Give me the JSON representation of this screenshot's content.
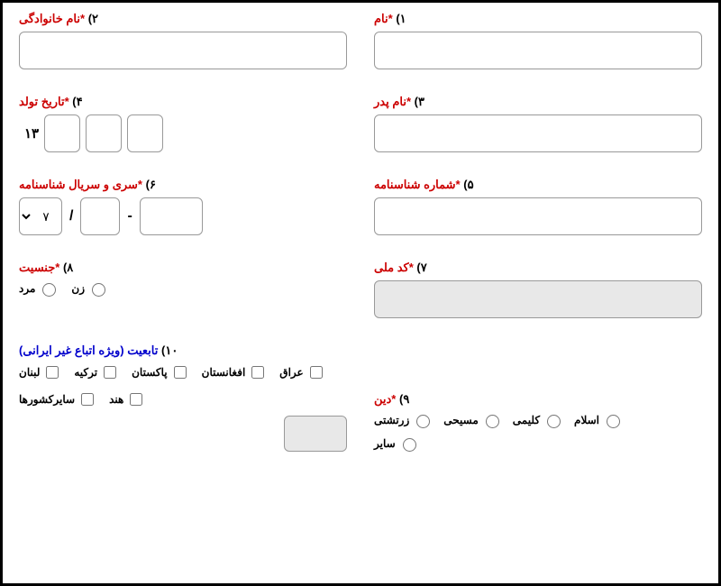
{
  "fields": {
    "f1": {
      "num": "۱)",
      "label": "*نام"
    },
    "f2": {
      "num": "۲)",
      "label": "*نام خانوادگی"
    },
    "f3": {
      "num": "۳)",
      "label": "*نام پدر"
    },
    "f4": {
      "num": "۴)",
      "label": "*تاریخ تولد",
      "prefix": "۱۳"
    },
    "f5": {
      "num": "۵)",
      "label": "*شماره شناسنامه"
    },
    "f6": {
      "num": "۶)",
      "label": "*سری و سریال شناسنامه",
      "sep1": "-",
      "sep2": "/",
      "dropdown": "۷"
    },
    "f7": {
      "num": "۷)",
      "label": "*کد ملی"
    },
    "f8": {
      "num": "۸)",
      "label": "*جنسیت",
      "opts": {
        "f": "زن",
        "m": "مرد"
      }
    },
    "f9": {
      "num": "۹)",
      "label": "*دین",
      "opts": {
        "islam": "اسلام",
        "kalimi": "کلیمی",
        "masihi": "مسیحی",
        "zartoshti": "زرتشتی",
        "other": "سایر"
      }
    },
    "f10": {
      "num": "۱۰)",
      "label": "تابعیت (ویژه اتباع غیر ایرانی)",
      "opts": {
        "iraq": "عراق",
        "afgh": "افغانستان",
        "pak": "پاکستان",
        "tur": "ترکیه",
        "leb": "لبنان",
        "ind": "هند",
        "other": "سایرکشورها"
      }
    }
  }
}
